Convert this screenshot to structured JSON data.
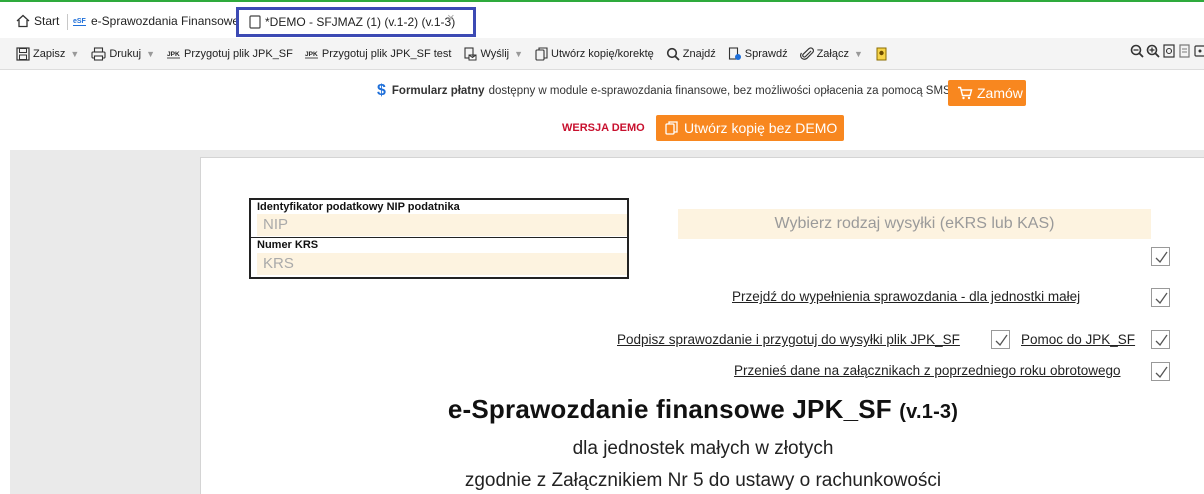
{
  "tabs": {
    "start": "Start",
    "esf": "e-Sprawozdania Finansowe",
    "active": "*DEMO - SFJMAZ (1) (v.1-2) (v.1-3)",
    "close": "×"
  },
  "toolbar": {
    "save": "Zapisz",
    "print": "Drukuj",
    "prepare_jpk": "Przygotuj plik JPK_SF",
    "prepare_jpk_test": "Przygotuj plik JPK_SF test",
    "send": "Wyślij",
    "copy_correction": "Utwórz kopię/korektę",
    "find": "Znajdź",
    "check": "Sprawdź",
    "attach": "Załącz",
    "arrow": "▼"
  },
  "notice": {
    "dollar": "$",
    "paid_bold": "Formularz płatny",
    "paid_text": "dostępny w module e-sprawozdania finansowe, bez możliwości opłacenia za pomocą SMS",
    "order_button": "Zamów",
    "demo_label": "WERSJA DEMO",
    "copy_button": "Utwórz kopię bez DEMO"
  },
  "form": {
    "nip_label": "Identyfikator podatkowy NIP podatnika",
    "nip_placeholder": "NIP",
    "krs_label": "Numer KRS",
    "krs_placeholder": "KRS",
    "send_type_placeholder": "Wybierz rodzaj wysyłki (eKRS lub KAS)",
    "link_fill_small": "Przejdź do wypełnienia sprawozdania - dla jednostki małej",
    "link_sign": "Podpisz sprawozdanie i przygotuj do wysyłki plik JPK_SF",
    "link_help": "Pomoc do JPK_SF",
    "link_transfer": "Przenieś dane na załącznikach z poprzedniego roku obrotowego"
  },
  "document": {
    "title": "e-Sprawozdanie finansowe JPK_SF",
    "version": "(v.1-3)",
    "subtitle1": "dla jednostek małych w złotych",
    "subtitle2": "zgodnie z Załącznikiem Nr 5 do ustawy o rachunkowości"
  },
  "colors": {
    "accent_orange": "#f8871f",
    "demo_red": "#c8102e",
    "tab_border": "#3c4ab4",
    "field_bg": "#fdf3e0",
    "top_line": "#2eaa3c"
  }
}
